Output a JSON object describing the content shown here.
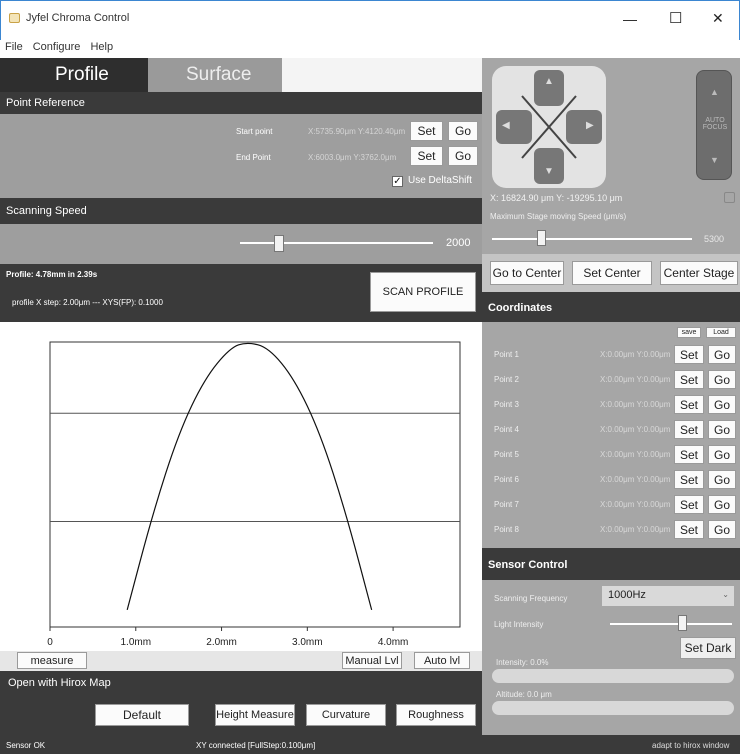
{
  "window": {
    "title": "Jyfel Chroma Control",
    "minimize": "—",
    "maximize": "☐",
    "close": "✕"
  },
  "menu": [
    "File",
    "Configure",
    "Help"
  ],
  "tabs": {
    "profile": "Profile",
    "surface": "Surface"
  },
  "point_reference": {
    "header": "Point Reference",
    "start_label": "Start point",
    "start_value": "X:5735.90μm Y:4120.40μm",
    "end_label": "End Point",
    "end_value": "X:6003.0μm Y:3762.0μm",
    "set": "Set",
    "go": "Go",
    "use_deltashift": "Use DeltaShift",
    "checkmark": "✓"
  },
  "scanning_speed": {
    "header": "Scanning Speed",
    "value": "2000",
    "slider_fraction": 0.2
  },
  "profile_info": {
    "line1": "Profile: 4.78mm in 2.39s",
    "line2": "profile X step: 2.00μm --- XYS(FP): 0.1000",
    "scan_button": "SCAN PROFILE"
  },
  "chart_data": {
    "type": "line",
    "x_ticks": [
      "0",
      "1.0mm",
      "2.0mm",
      "3.0mm",
      "4.0mm"
    ],
    "xlim": [
      0,
      4.78
    ],
    "series": [
      {
        "values": [
          [
            0.9,
            0.06
          ],
          [
            1.2,
            0.4
          ],
          [
            1.5,
            0.68
          ],
          [
            1.8,
            0.87
          ],
          [
            2.1,
            0.98
          ],
          [
            2.3,
            1.0
          ],
          [
            2.55,
            0.98
          ],
          [
            2.85,
            0.87
          ],
          [
            3.15,
            0.68
          ],
          [
            3.45,
            0.4
          ],
          [
            3.75,
            0.06
          ]
        ]
      }
    ],
    "hlines": [
      0.75,
      0.37
    ]
  },
  "chart_buttons": {
    "measure": "measure",
    "manual": "Manual Lvl",
    "auto": "Auto lvl"
  },
  "hirox": {
    "header": "Open with Hirox Map",
    "buttons": [
      "Default",
      "Height Measure",
      "Curvature",
      "Roughness"
    ]
  },
  "stage": {
    "coords": "X: 16824.90 μm  Y: -19295.10 μm",
    "speed_label": "Maximum Stage moving Speed (μm/s)",
    "speed_value": "5300",
    "speed_fraction": 0.25,
    "auto_focus": "AUTO FOCUS",
    "go_center": "Go to Center",
    "set_center": "Set Center",
    "center_stage": "Center Stage"
  },
  "coordinates": {
    "header": "Coordinates",
    "save": "save",
    "load": "Load",
    "rows": [
      {
        "name": "Point 1",
        "value": "X:0.00μm Y:0.00μm"
      },
      {
        "name": "Point 2",
        "value": "X:0.00μm Y:0.00μm"
      },
      {
        "name": "Point 3",
        "value": "X:0.00μm Y:0.00μm"
      },
      {
        "name": "Point 4",
        "value": "X:0.00μm Y:0.00μm"
      },
      {
        "name": "Point 5",
        "value": "X:0.00μm Y:0.00μm"
      },
      {
        "name": "Point 6",
        "value": "X:0.00μm Y:0.00μm"
      },
      {
        "name": "Point 7",
        "value": "X:0.00μm Y:0.00μm"
      },
      {
        "name": "Point 8",
        "value": "X:0.00μm Y:0.00μm"
      }
    ],
    "set": "Set",
    "go": "Go"
  },
  "sensor": {
    "header": "Sensor Control",
    "freq_label": "Scanning Frequency",
    "freq_value": "1000Hz",
    "light_label": "Light Intensity",
    "light_fraction": 0.6,
    "set_dark": "Set Dark",
    "intensity": "Intensity: 0.0%",
    "altitude": "Altitude: 0.0 μm"
  },
  "statusbar": {
    "left": "Sensor OK",
    "middle": "XY connected [FullStep:0.100μm]",
    "right": "adapt to hirox window"
  }
}
